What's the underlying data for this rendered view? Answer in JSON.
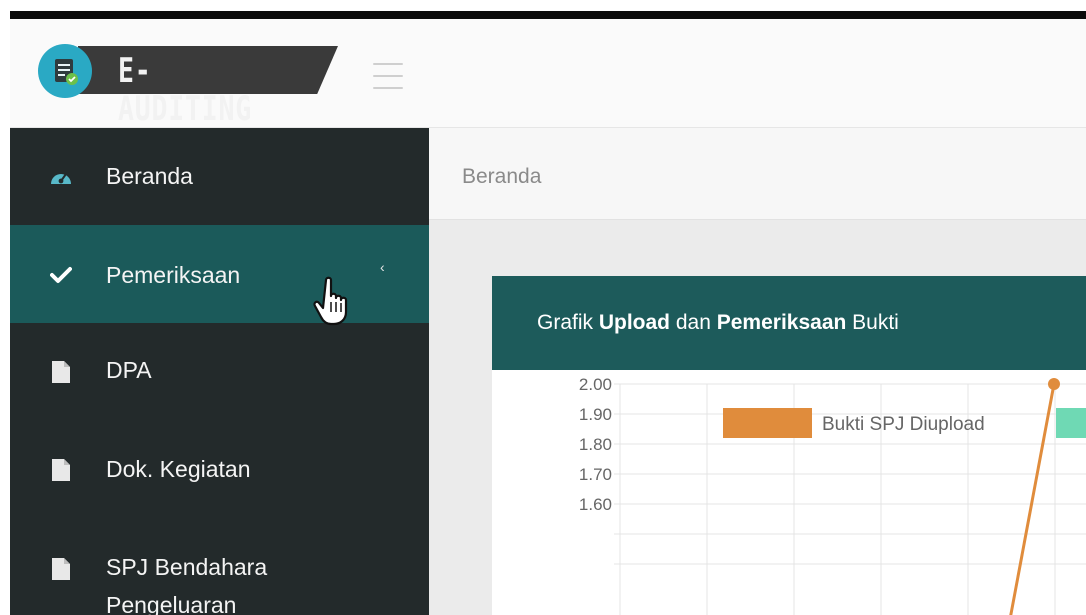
{
  "app": {
    "logo_text": "E-AUDITING"
  },
  "sidebar": {
    "items": [
      {
        "label": "Beranda",
        "icon": "dashboard-icon"
      },
      {
        "label": "Pemeriksaan",
        "icon": "check-icon",
        "active": true
      },
      {
        "label": "DPA",
        "icon": "file-icon"
      },
      {
        "label": "Dok. Kegiatan",
        "icon": "file-icon"
      },
      {
        "label": "SPJ Bendahara",
        "label2": "Pengeluaran",
        "icon": "file-icon"
      }
    ]
  },
  "breadcrumb": "Beranda",
  "panel": {
    "title_pre": "Grafik ",
    "title_b1": "Upload",
    "title_mid": " dan ",
    "title_b2": "Pemeriksaan",
    "title_post": " Bukti"
  },
  "colors": {
    "sidebar_bg": "#232a2b",
    "sidebar_active": "#1b5a5a",
    "panel_header": "#1d5b5b",
    "series_upload": "#e08c3c",
    "series_pemeriksaan": "#6fd9b4"
  },
  "chart_data": {
    "type": "line",
    "title": "",
    "xlabel": "",
    "ylabel": "",
    "ylim": [
      1.6,
      2.0
    ],
    "y_ticks": [
      "2.00",
      "1.90",
      "1.80",
      "1.70",
      "1.60"
    ],
    "grid": true,
    "legend_position": "top",
    "series": [
      {
        "name": "Bukti SPJ Diupload",
        "color": "#e08c3c",
        "values": [
          2.0
        ]
      },
      {
        "name": "",
        "color": "#6fd9b4",
        "values": []
      }
    ]
  }
}
